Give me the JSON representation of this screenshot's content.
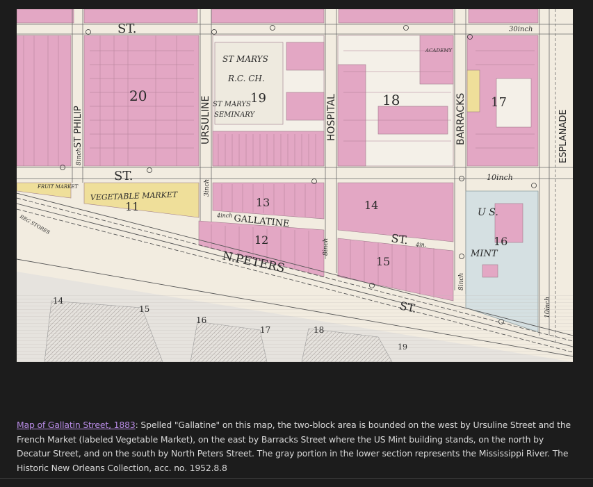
{
  "map": {
    "street_labels": {
      "st_top": "ST.",
      "st_mid": "ST.",
      "st_lower": "ST.",
      "st_bottom": "ST.",
      "st_philip": "ST PHILIP",
      "ursuline": "URSULINE",
      "hospital": "HOSPITAL",
      "barracks": "BARRACKS",
      "esplanade": "ESPLANADE",
      "gallatine": "GALLATINE",
      "n_peters": "N.PETERS"
    },
    "place_labels": {
      "st_marys": "ST MARYS",
      "rc_ch": "R.C. CH.",
      "st_marys_seminary_1": "ST MARYS",
      "st_marys_seminary_2": "SEMINARY",
      "vegetable_market": "VEGETABLE MARKET",
      "us": "U S.",
      "mint": "MINT",
      "academy": "ACADEMY",
      "fruit_market": "FRUIT MARKET",
      "reg_stores": "REG STORES"
    },
    "block_numbers": [
      "20",
      "19",
      "18",
      "17",
      "11",
      "13",
      "14",
      "12",
      "15",
      "16"
    ],
    "wharf_numbers": [
      "14",
      "15",
      "16",
      "17",
      "18",
      "19"
    ],
    "inch_labels": {
      "top_right": "30inch",
      "mid_right": "10inch",
      "left_vertical": "8inch",
      "ursuline_vertical": "3inch",
      "gallatine_inch": "4inch",
      "hospital_vertical": "8inch",
      "barracks_vertical": "8inch",
      "esplanade_vertical": "10inch",
      "st_inch": "4in."
    },
    "colors": {
      "pink": "#e3a7c4",
      "yellow": "#efdf9a",
      "paper": "#f2ece0",
      "river": "#d9d6d2",
      "mint_blue": "#d5e0e2"
    }
  },
  "caption": {
    "link_text": "Map of Gallatin Street, 1883",
    "body": ": Spelled \"Gallatine\" on this map, the two-block area is bounded on the west by Ursuline Street and the French Market (labeled Vegetable Market), on the east by Barracks Street where the US Mint building stands, on the north by Decatur Street, and on the south by North Peters Street. The gray portion in the lower section represents the Mississippi River. The Historic New Orleans Collection, acc. no. 1952.8.8"
  }
}
